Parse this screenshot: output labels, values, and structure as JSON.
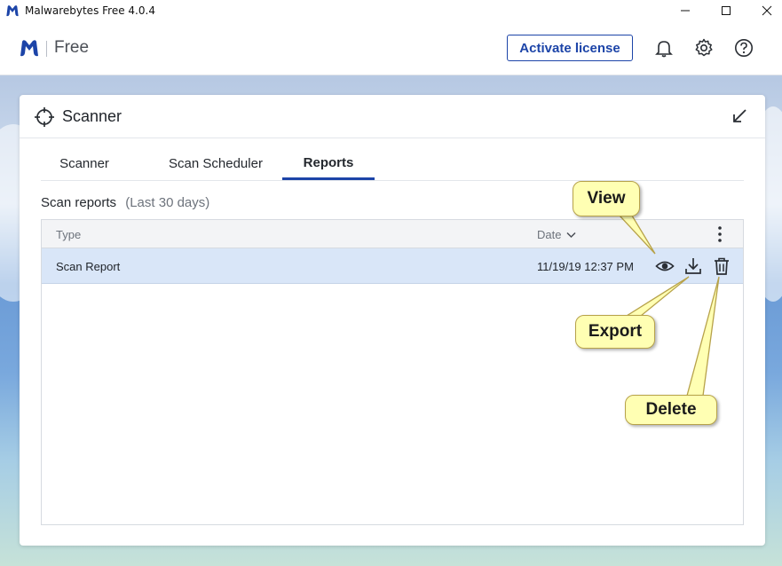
{
  "window": {
    "title": "Malwarebytes Free  4.0.4"
  },
  "header": {
    "brand": "Free",
    "activate_label": "Activate license"
  },
  "panel": {
    "title": "Scanner",
    "tabs": [
      {
        "label": "Scanner"
      },
      {
        "label": "Scan Scheduler"
      },
      {
        "label": "Reports",
        "active": true
      }
    ],
    "section_title": "Scan reports",
    "section_hint": "(Last 30 days)"
  },
  "table": {
    "columns": {
      "type": "Type",
      "date": "Date"
    },
    "rows": [
      {
        "type": "Scan Report",
        "date": "11/19/19 12:37 PM"
      }
    ]
  },
  "callouts": {
    "view": "View",
    "export": "Export",
    "delete": "Delete"
  },
  "colors": {
    "accent": "#1c44a8",
    "callout_fill": "#ffffb3",
    "row_selected": "#d9e6f8"
  },
  "icons": [
    "malwarebytes-logo-icon",
    "bell-icon",
    "gear-icon",
    "help-icon",
    "crosshair-icon",
    "collapse-arrow-icon",
    "kebab-menu-icon",
    "eye-icon",
    "download-icon",
    "trash-icon",
    "chevron-down-icon"
  ]
}
